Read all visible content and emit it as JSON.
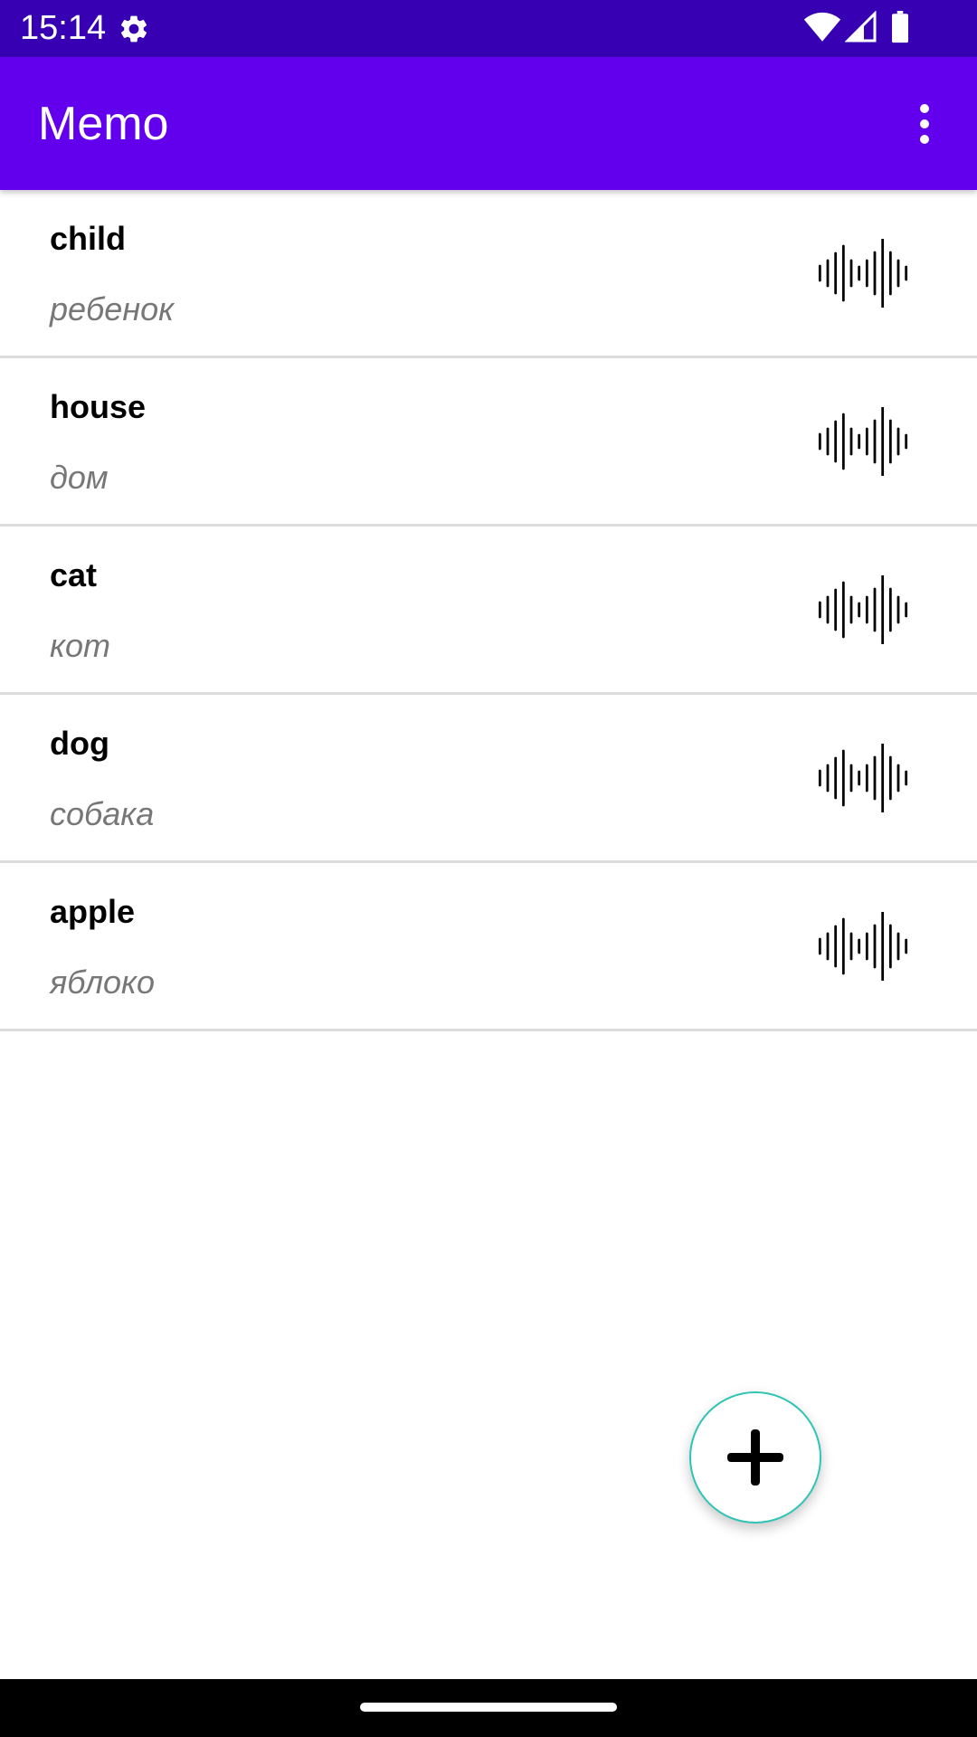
{
  "status_bar": {
    "time": "15:14",
    "icons": [
      "gear-icon",
      "wifi-icon",
      "signal-icon",
      "battery-icon"
    ],
    "background": "#3700b3"
  },
  "app_bar": {
    "title": "Memo",
    "menu_icon": "more-vert-icon",
    "background": "#6200ee"
  },
  "words": [
    {
      "word": "child",
      "translation": "ребенок",
      "icon": "audio-wave-icon"
    },
    {
      "word": "house",
      "translation": "дом",
      "icon": "audio-wave-icon"
    },
    {
      "word": "cat",
      "translation": "кот",
      "icon": "audio-wave-icon"
    },
    {
      "word": "dog",
      "translation": "собака",
      "icon": "audio-wave-icon"
    },
    {
      "word": "apple",
      "translation": "яблоко",
      "icon": "audio-wave-icon"
    }
  ],
  "fab": {
    "icon": "plus-icon",
    "border_color": "#2ec4b6"
  },
  "colors": {
    "translation_text": "#777777",
    "divider": "#dcdcdc"
  }
}
